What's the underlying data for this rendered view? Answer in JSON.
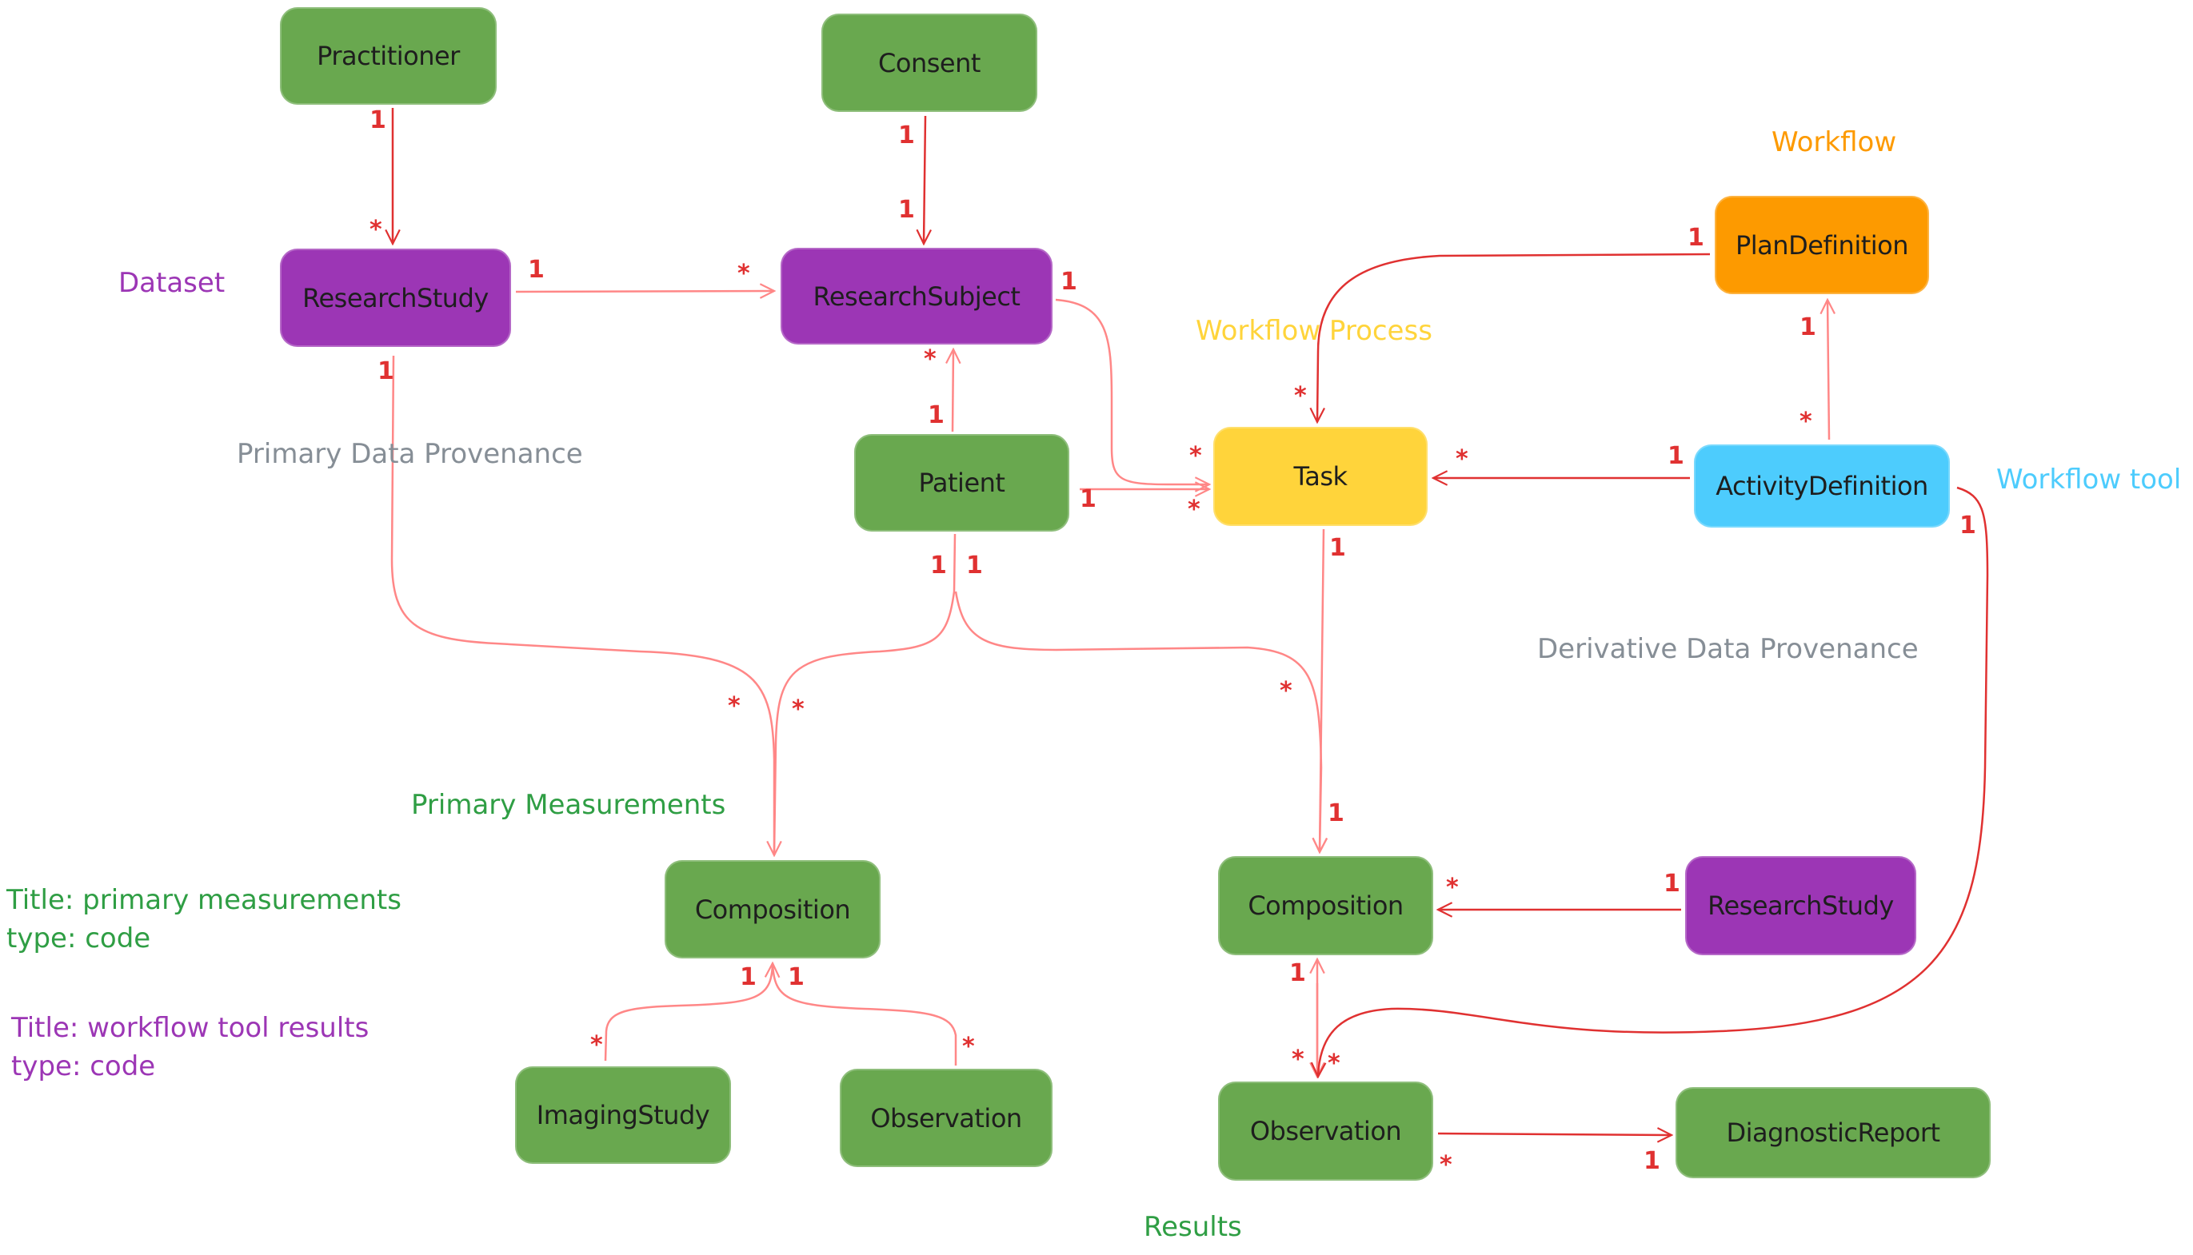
{
  "colors": {
    "green": "#69a84f",
    "purple": "#9c36b5",
    "orange": "#fd9a00",
    "yellow": "#ffd43b",
    "cyan": "#4dccfd",
    "edge": "#ff8787",
    "edge_dark": "#e03131",
    "multiplicity": "#e03131",
    "label_gray": "#868e96",
    "label_green": "#2f9e44"
  },
  "nodes": {
    "practitioner": {
      "label": "Practitioner",
      "color": "green"
    },
    "consent": {
      "label": "Consent",
      "color": "green"
    },
    "research_study_top": {
      "label": "ResearchStudy",
      "color": "purple"
    },
    "research_subject": {
      "label": "ResearchSubject",
      "color": "purple"
    },
    "plan_definition": {
      "label": "PlanDefinition",
      "color": "orange"
    },
    "task": {
      "label": "Task",
      "color": "yellow"
    },
    "patient": {
      "label": "Patient",
      "color": "green"
    },
    "activity_definition": {
      "label": "ActivityDefinition",
      "color": "cyan"
    },
    "composition_primary": {
      "label": "Composition",
      "color": "green"
    },
    "composition_results": {
      "label": "Composition",
      "color": "green"
    },
    "research_study_results": {
      "label": "ResearchStudy",
      "color": "purple"
    },
    "imaging_study": {
      "label": "ImagingStudy",
      "color": "green"
    },
    "observation_primary": {
      "label": "Observation",
      "color": "green"
    },
    "observation_results": {
      "label": "Observation",
      "color": "green"
    },
    "diagnostic_report": {
      "label": "DiagnosticReport",
      "color": "green"
    }
  },
  "labels": {
    "dataset": "Dataset",
    "workflow": "Workflow",
    "workflow_process": "Workflow Process",
    "workflow_tool": "Workflow tool",
    "primary_data_provenance": "Primary Data Provenance",
    "derivative_data_provenance": "Derivative Data Provenance",
    "primary_measurements": "Primary Measurements",
    "results": "Results"
  },
  "notes": {
    "primary": "Title: primary measurements\ntype: code",
    "workflow_results": "Title: workflow tool results\ntype: code"
  },
  "edges": [
    {
      "from": "Practitioner",
      "to": "ResearchStudy",
      "from_mult": "1",
      "to_mult": "*"
    },
    {
      "from": "Consent",
      "to": "ResearchSubject",
      "from_mult": "1",
      "to_mult": "1"
    },
    {
      "from": "ResearchStudy",
      "to": "ResearchSubject",
      "from_mult": "1",
      "to_mult": "*"
    },
    {
      "from": "Patient",
      "to": "ResearchSubject",
      "from_mult": "1",
      "to_mult": "*"
    },
    {
      "from": "ResearchSubject",
      "to": "Task",
      "from_mult": "1",
      "to_mult": "*"
    },
    {
      "from": "Patient",
      "to": "Task",
      "from_mult": "1",
      "to_mult": "*"
    },
    {
      "from": "PlanDefinition",
      "to": "Task",
      "from_mult": "1",
      "to_mult": "*"
    },
    {
      "from": "ActivityDefinition",
      "to": "Task",
      "from_mult": "1",
      "to_mult": "*"
    },
    {
      "from": "ActivityDefinition",
      "to": "PlanDefinition",
      "from_mult": "*",
      "to_mult": "1"
    },
    {
      "from": "ResearchStudy",
      "to": "Composition (primary)",
      "from_mult": "1",
      "to_mult": "*"
    },
    {
      "from": "Patient",
      "to": "Composition (primary)",
      "from_mult": "1",
      "to_mult": "*"
    },
    {
      "from": "Patient",
      "to": "Composition (results)",
      "from_mult": "1",
      "to_mult": "*"
    },
    {
      "from": "Task",
      "to": "Composition (results)",
      "from_mult": "1",
      "to_mult": "1"
    },
    {
      "from": "ResearchStudy (results)",
      "to": "Composition (results)",
      "from_mult": "1",
      "to_mult": "*"
    },
    {
      "from": "ImagingStudy",
      "to": "Composition (primary)",
      "from_mult": "*",
      "to_mult": "1"
    },
    {
      "from": "Observation (primary)",
      "to": "Composition (primary)",
      "from_mult": "*",
      "to_mult": "1"
    },
    {
      "from": "Composition (results)",
      "to": "Observation (results)",
      "from_mult": "1",
      "to_mult": "*"
    },
    {
      "from": "ActivityDefinition",
      "to": "Observation (results)",
      "from_mult": "1",
      "to_mult": "*"
    },
    {
      "from": "Observation (results)",
      "to": "DiagnosticReport",
      "from_mult": "*",
      "to_mult": "1"
    }
  ],
  "multiplicity": {
    "one": "1",
    "many": "*"
  }
}
